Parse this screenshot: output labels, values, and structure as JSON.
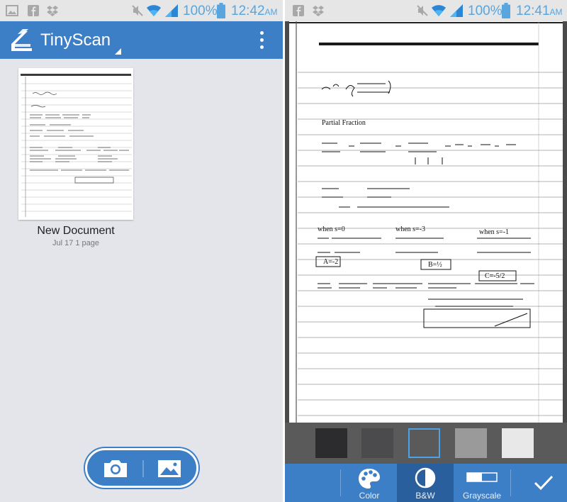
{
  "left_screen": {
    "status_bar": {
      "battery_percent": "100%",
      "time": "12:42",
      "ampm": "AM",
      "icons": [
        "gallery-icon",
        "facebook-icon",
        "dropbox-icon",
        "mute-icon",
        "wifi-icon",
        "signal-icon",
        "battery-icon"
      ]
    },
    "app_bar": {
      "title": "TinyScan",
      "logo_icon": "scanner-logo-icon",
      "menu_icon": "overflow-menu-icon"
    },
    "documents": [
      {
        "name": "New Document",
        "meta": "Jul 17  1 page"
      }
    ],
    "capture_bar": {
      "buttons": [
        "camera-icon",
        "gallery-image-icon"
      ]
    }
  },
  "right_screen": {
    "status_bar": {
      "battery_percent": "100%",
      "time": "12:41",
      "ampm": "AM",
      "icons": [
        "facebook-icon",
        "dropbox-icon",
        "mute-icon",
        "wifi-icon",
        "signal-icon",
        "battery-icon"
      ]
    },
    "page_text": {
      "line1": "Partial Fraction",
      "case1": "when s=0",
      "case2": "when s=-3",
      "case3": "when s=-1",
      "ans1": "A=-2",
      "ans2": "B=½",
      "ans3": "C=-5/2"
    },
    "swatches": [
      {
        "color": "#2c2c2e",
        "selected": false
      },
      {
        "color": "#4b4b4d",
        "selected": false
      },
      {
        "color": "#5a5a5a",
        "selected": true
      },
      {
        "color": "#9a9a9a",
        "selected": false
      },
      {
        "color": "#e8e8e8",
        "selected": false
      }
    ],
    "filters": [
      {
        "label": "Color",
        "icon": "palette-icon",
        "active": false
      },
      {
        "label": "B&W",
        "icon": "contrast-icon",
        "active": true
      },
      {
        "label": "Grayscale",
        "icon": "grayscale-bar-icon",
        "active": false
      }
    ],
    "confirm_icon": "checkmark-icon"
  },
  "colors": {
    "primary": "#3d7fc6",
    "primary_dark": "#2a5f9e",
    "status_text": "#58a5df",
    "background": "#e4e5ea"
  }
}
